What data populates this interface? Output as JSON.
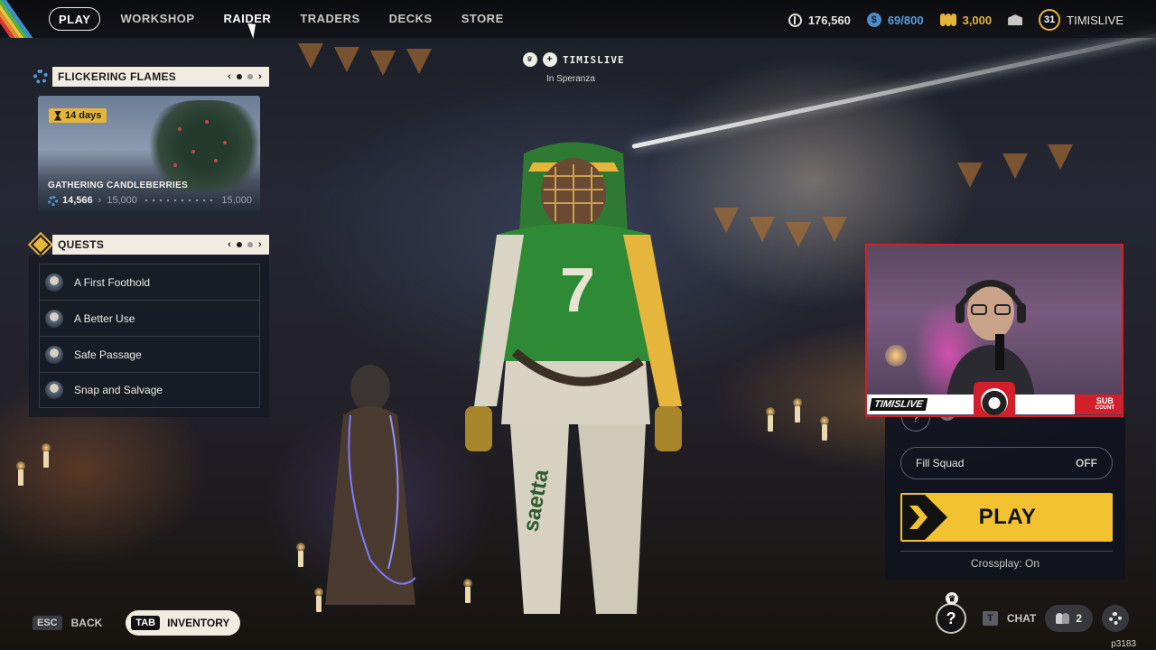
{
  "nav": {
    "items": [
      {
        "label": "PLAY",
        "active": true
      },
      {
        "label": "WORKSHOP"
      },
      {
        "label": "RAIDER",
        "hover": true
      },
      {
        "label": "TRADERS"
      },
      {
        "label": "DECKS"
      },
      {
        "label": "STORE"
      }
    ]
  },
  "currencies": {
    "credits": "176,560",
    "tokens": "69/800",
    "coins": "3,000",
    "level": "31",
    "username": "TIMISLIVE"
  },
  "player": {
    "name": "TIMISLIVE",
    "location": "In Speranza"
  },
  "event": {
    "title": "FLICKERING FLAMES",
    "timer": "14 days",
    "card_title": "GATHERING CANDLEBERRIES",
    "progress_current": "14,566",
    "progress_next": "15,000",
    "progress_max": "15,000",
    "pager_page": 1,
    "pager_total": 2
  },
  "quests": {
    "title": "QUESTS",
    "items": [
      {
        "label": "A First Foothold"
      },
      {
        "label": "A Better Use"
      },
      {
        "label": "Safe Passage"
      },
      {
        "label": "Snap and Salvage"
      }
    ],
    "pager_page": 1,
    "pager_total": 2
  },
  "stream": {
    "name_tag": "TIMISLIVE",
    "sub_line1": "SUB",
    "sub_line2": "COUNT"
  },
  "play_panel": {
    "help_glyph": "?",
    "info_glyph": "i",
    "fill_squad_label": "Fill Squad",
    "fill_squad_value": "OFF",
    "play_label": "PLAY",
    "crossplay": "Crossplay: On"
  },
  "bottom": {
    "esc_key": "ESC",
    "back_label": "BACK",
    "tab_key": "TAB",
    "inventory_label": "INVENTORY",
    "help_glyph": "?",
    "chat_key": "T",
    "chat_label": "CHAT",
    "squad_count": "2",
    "build_id": "p3183"
  },
  "colors": {
    "accent_yellow": "#f2c230",
    "panel_header": "#f1ece1",
    "stream_red": "#d21f2c"
  },
  "icons": [
    "credits-icon",
    "token-icon",
    "coins-icon",
    "mail-icon",
    "gear-icon",
    "diamond-icon",
    "hourglass-icon",
    "help-icon",
    "people-icon",
    "settings-icon"
  ]
}
